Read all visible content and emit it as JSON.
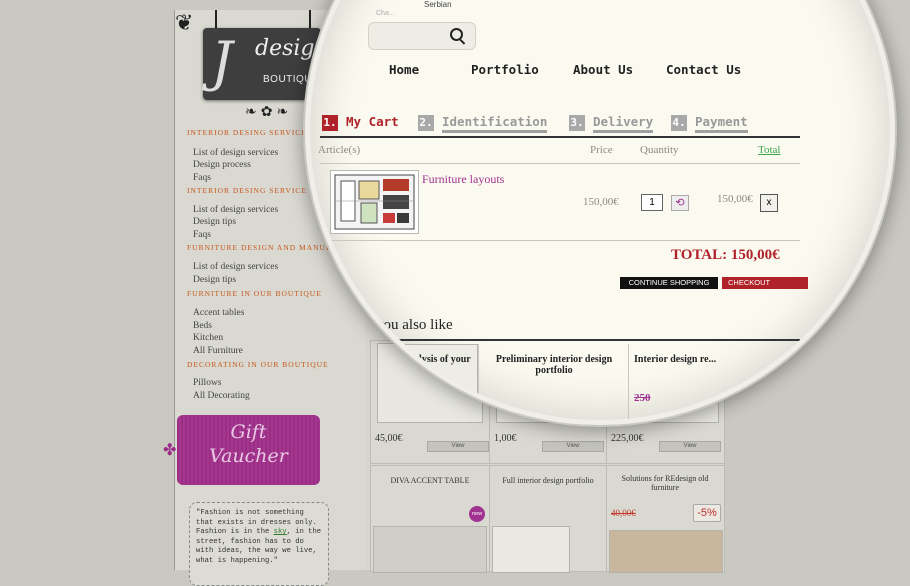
{
  "header": {
    "language": "Serbian",
    "search_placeholder": "Cha..."
  },
  "logo": {
    "letter": "J",
    "word": "design",
    "sub": "BOUTIQUE"
  },
  "nav": [
    "Home",
    "Portfolio",
    "About Us",
    "Contact Us"
  ],
  "sidebar": {
    "categories": [
      {
        "title": "INTERIOR DESING SERVICE ONLINE",
        "items": [
          "List of design services",
          "Design process",
          "Faqs"
        ]
      },
      {
        "title": "INTERIOR DESING SERVICE IN BOU...",
        "items": [
          "List of design services",
          "Design tips",
          "Faqs"
        ]
      },
      {
        "title": "FURNITURE DESIGN AND MANUFACTURE",
        "items": [
          "List of design services",
          "Design tips"
        ]
      },
      {
        "title": "FURNITURE IN OUR BOUTIQUE",
        "items": [
          "Accent tables",
          "Beds",
          "Kitchen",
          "All Furniture"
        ]
      },
      {
        "title": "DECORATING IN OUR BOUTIQUE",
        "items": [
          "Pillows",
          "All Decorating"
        ]
      }
    ],
    "gift": {
      "line1": "Gift",
      "line2": "Vaucher"
    },
    "quote": {
      "pre": "\"Fashion is not something that exists in dresses only. Fashion is in the ",
      "link": "sky",
      "post": ", in the street, fashion has to do with ideas, the way we live, what is happening.\""
    }
  },
  "checkout_steps": [
    {
      "num": "1.",
      "label": "My Cart",
      "active": true
    },
    {
      "num": "2.",
      "label": "Identification",
      "active": false
    },
    {
      "num": "3.",
      "label": "Delivery",
      "active": false
    },
    {
      "num": "4.",
      "label": "Payment",
      "active": false
    }
  ],
  "cart": {
    "columns": {
      "article": "Article(s)",
      "price": "Price",
      "quantity": "Quantity",
      "total": "Total"
    },
    "items": [
      {
        "name": "Furniture layouts",
        "price": "150,00€",
        "quantity": "1",
        "total": "150,00€",
        "remove": "x"
      }
    ],
    "grand_total": "TOTAL: 150,00€",
    "continue_label": "CONTINUE SHOPPING",
    "checkout_label": "CHECKOUT"
  },
  "also_like": {
    "title": "you also like",
    "row1": [
      {
        "title": "Analysis of your",
        "price": "45,00€",
        "view": "View"
      },
      {
        "title": "Preliminary interior design portfolio",
        "price": "1,00€",
        "view": "View"
      },
      {
        "title": "Interior design re...",
        "price": "225,00€",
        "view": "View",
        "old_price": "250"
      }
    ],
    "row2": [
      {
        "title": "DIVA ACCENT TABLE",
        "badge": "new"
      },
      {
        "title": "Full interior design portfolio"
      },
      {
        "title": "Solutions for REdesign old furniture",
        "old_price": "40,00€",
        "discount": "-5%"
      }
    ]
  }
}
